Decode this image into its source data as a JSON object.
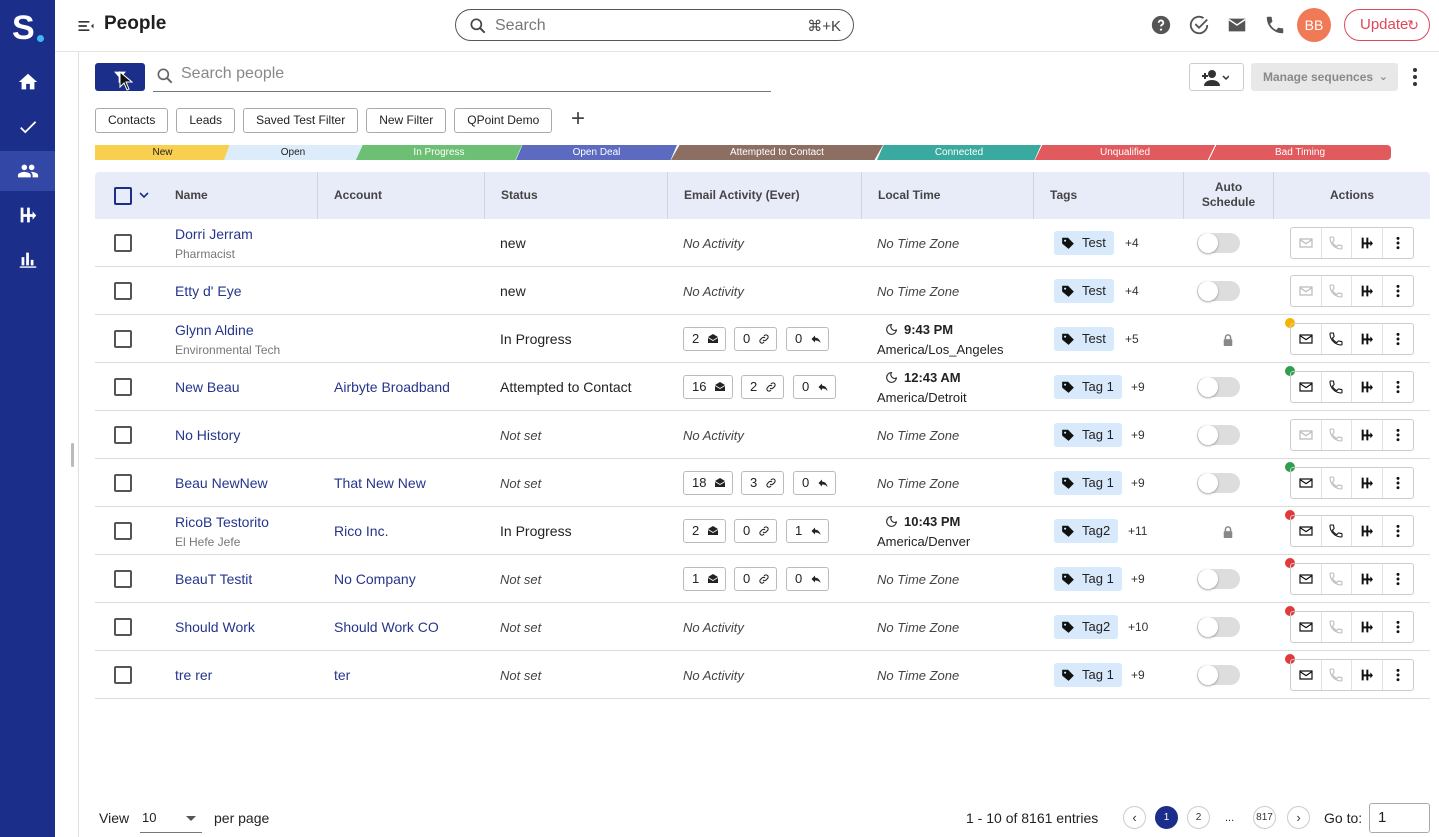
{
  "app": {
    "logo_letter": "S",
    "accent": "#1a2e8a"
  },
  "header": {
    "title": "People",
    "search_placeholder": "Search",
    "search_shortcut": "⌘+K",
    "avatar_initials": "BB",
    "update_label": "Update"
  },
  "toolbar": {
    "search_placeholder": "Search people",
    "manage_sequences_label": "Manage sequences"
  },
  "filter_chips": [
    "Contacts",
    "Leads",
    "Saved Test Filter",
    "New Filter",
    "QPoint Demo"
  ],
  "stages": [
    {
      "label": "New",
      "color": "#f9cf4f",
      "text": "#222"
    },
    {
      "label": "Open",
      "color": "#dcecfa",
      "text": "#222"
    },
    {
      "label": "In Progress",
      "color": "#6cbf73",
      "text": "#fff"
    },
    {
      "label": "Open Deal",
      "color": "#5c6bc0",
      "text": "#fff"
    },
    {
      "label": "Attempted to Contact",
      "color": "#8d6e63",
      "text": "#fff"
    },
    {
      "label": "Connected",
      "color": "#3aa99f",
      "text": "#fff"
    },
    {
      "label": "Unqualified",
      "color": "#e05a5e",
      "text": "#fff"
    },
    {
      "label": "Bad Timing",
      "color": "#e05a5e",
      "text": "#fff"
    }
  ],
  "columns": {
    "name": "Name",
    "account": "Account",
    "status": "Status",
    "email_activity": "Email Activity (Ever)",
    "local_time": "Local Time",
    "tags": "Tags",
    "auto_schedule_1": "Auto",
    "auto_schedule_2": "Schedule",
    "actions": "Actions"
  },
  "rows": [
    {
      "name": "Dorri Jerram",
      "title": "Pharmacist",
      "account": "",
      "status": "new",
      "status_italic": false,
      "no_activity": "No Activity",
      "local_time": "No Time Zone",
      "tag": "Test",
      "tag_more": "+4",
      "auto": "toggle",
      "active_actions": false,
      "badge": ""
    },
    {
      "name": "Etty d' Eye",
      "title": "",
      "account": "",
      "status": "new",
      "status_italic": false,
      "no_activity": "No Activity",
      "local_time": "No Time Zone",
      "tag": "Test",
      "tag_more": "+4",
      "auto": "toggle",
      "active_actions": false,
      "badge": ""
    },
    {
      "name": "Glynn Aldine",
      "title": "Environmental Tech",
      "account": "",
      "status": "In Progress",
      "status_italic": false,
      "emails": [
        "2",
        "0",
        "0"
      ],
      "time": "9:43 PM",
      "zone": "America/Los_Angeles",
      "tag": "Test",
      "tag_more": "+5",
      "auto": "lock",
      "active_actions": true,
      "phone_active": true,
      "badge": "#f5b400"
    },
    {
      "name": "New Beau",
      "title": "",
      "account": "Airbyte Broadband",
      "status": "Attempted to Contact",
      "status_italic": false,
      "emails": [
        "16",
        "2",
        "0"
      ],
      "time": "12:43 AM",
      "zone": "America/Detroit",
      "tag": "Tag 1",
      "tag_more": "+9",
      "auto": "toggle",
      "active_actions": true,
      "phone_active": true,
      "badge": "#2e9e4f"
    },
    {
      "name": "No History",
      "title": "",
      "account": "",
      "status": "Not set",
      "status_italic": true,
      "no_activity": "No Activity",
      "local_time": "No Time Zone",
      "tag": "Tag 1",
      "tag_more": "+9",
      "auto": "toggle",
      "active_actions": false,
      "badge": ""
    },
    {
      "name": "Beau NewNew",
      "title": "",
      "account": "That New New",
      "status": "Not set",
      "status_italic": true,
      "emails": [
        "18",
        "3",
        "0"
      ],
      "local_time": "No Time Zone",
      "tag": "Tag 1",
      "tag_more": "+9",
      "auto": "toggle",
      "active_actions": true,
      "phone_active": false,
      "badge": "#2e9e4f"
    },
    {
      "name": "RicoB Testorito",
      "title": "El Hefe Jefe",
      "account": "Rico Inc.",
      "status": "In Progress",
      "status_italic": false,
      "emails": [
        "2",
        "0",
        "1"
      ],
      "time": "10:43 PM",
      "zone": "America/Denver",
      "tag": "Tag2",
      "tag_more": "+11",
      "auto": "lock",
      "active_actions": true,
      "phone_active": true,
      "badge": "#e03a3a"
    },
    {
      "name": "BeauT Testit",
      "title": "",
      "account": "No Company",
      "status": "Not set",
      "status_italic": true,
      "emails": [
        "1",
        "0",
        "0"
      ],
      "local_time": "No Time Zone",
      "tag": "Tag 1",
      "tag_more": "+9",
      "auto": "toggle",
      "active_actions": true,
      "phone_active": false,
      "badge": "#e03a3a"
    },
    {
      "name": "Should Work",
      "title": "",
      "account": "Should Work CO",
      "status": "Not set",
      "status_italic": true,
      "no_activity": "No Activity",
      "local_time": "No Time Zone",
      "tag": "Tag2",
      "tag_more": "+10",
      "auto": "toggle",
      "active_actions": true,
      "phone_active": false,
      "badge": "#e03a3a"
    },
    {
      "name": "tre rer",
      "title": "",
      "account": "ter",
      "status": "Not set",
      "status_italic": true,
      "no_activity": "No Activity",
      "local_time": "No Time Zone",
      "tag": "Tag 1",
      "tag_more": "+9",
      "auto": "toggle",
      "active_actions": true,
      "phone_active": false,
      "badge": "#e03a3a"
    }
  ],
  "footer": {
    "view_label": "View",
    "per_page_value": "10",
    "per_page_label": "per page",
    "entries": "1 - 10 of 8161 entries",
    "pages": [
      "1",
      "2"
    ],
    "ellipsis": "...",
    "last_page": "817",
    "goto_label": "Go to:",
    "goto_value": "1"
  }
}
